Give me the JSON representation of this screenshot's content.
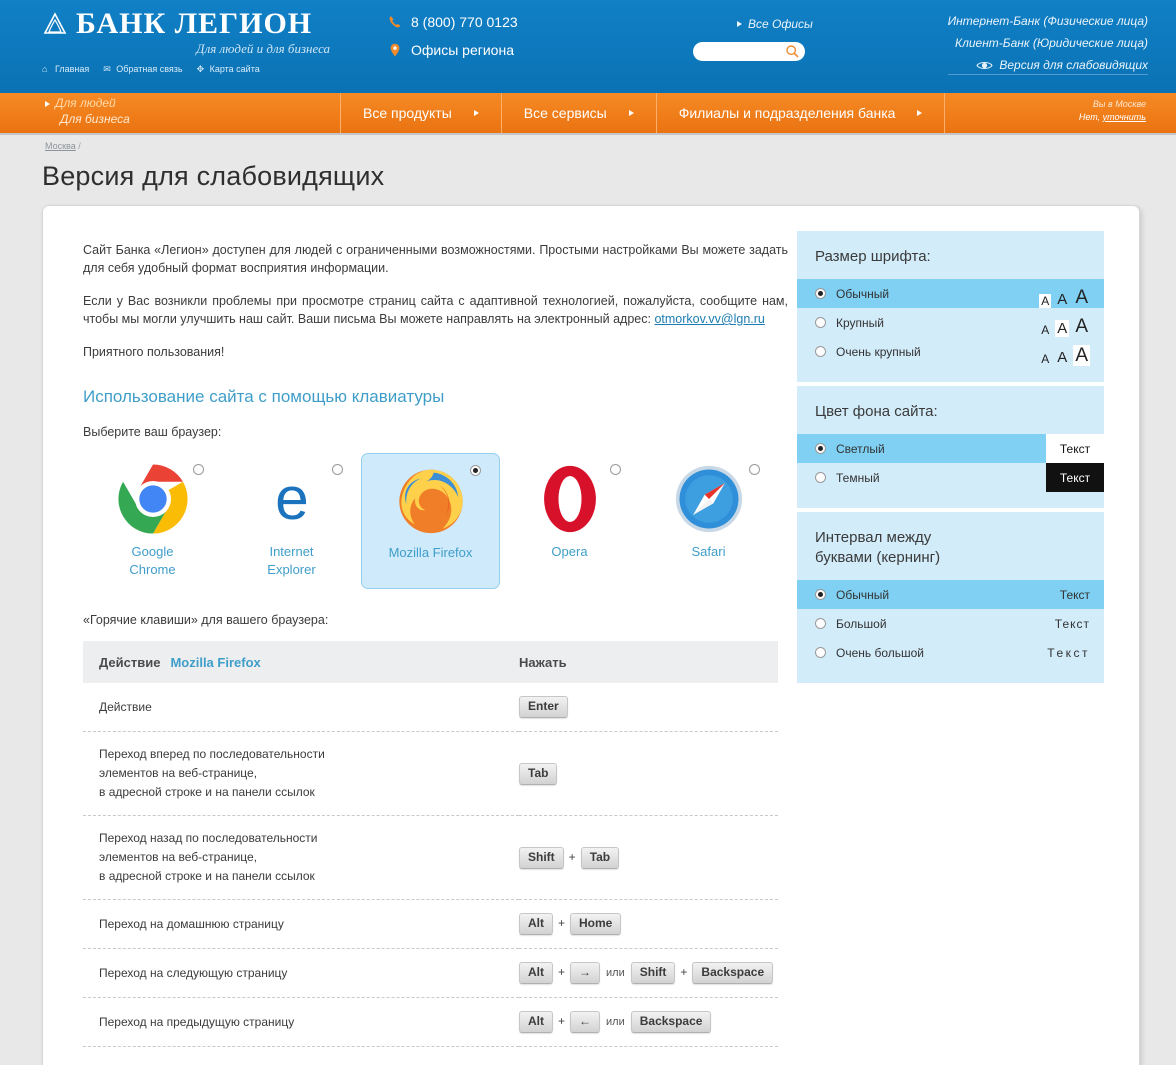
{
  "header": {
    "logo_name": "БАНК ЛЕГИОН",
    "logo_tagline": "Для людей и для бизнеса",
    "top_links": [
      {
        "icon": "home-icon",
        "label": "Главная"
      },
      {
        "icon": "envelope-icon",
        "label": "Обратная связь"
      },
      {
        "icon": "sitemap-icon",
        "label": "Карта сайта"
      }
    ],
    "phone": "8 (800) 770 0123",
    "offices_region": "Офисы региона",
    "all_offices": "Все Офисы",
    "search_placeholder": "",
    "search_value": "",
    "right_links": [
      "Интернет-Банк (Физические лица)",
      "Клиент-Банк (Юридические лица)"
    ],
    "accessibility_link": "Версия для слабовидящих"
  },
  "nav": {
    "audience": [
      {
        "label": "Для людей",
        "active": true
      },
      {
        "label": "Для бизнеса",
        "active": false
      }
    ],
    "items": [
      "Все продукты",
      "Все сервисы",
      "Филиалы и подразделения банка"
    ],
    "geo_line1": "Вы в Москве",
    "geo_line2_prefix": "Нет, ",
    "geo_line2_link": "уточнить"
  },
  "breadcrumb": {
    "city": "Москва",
    "separator": "/"
  },
  "page_title": "Версия для слабовидящих",
  "content": {
    "paragraph1": "Сайт Банка «Легион» доступен для людей с ограниченными возможностями. Простыми настройками Вы можете задать для себя удобный формат восприятия информации.",
    "paragraph2_before": "Если у Вас возникли проблемы при просмотре страниц сайта с адаптивной технологией, пожалуйста, сообщите нам, чтобы мы могли улучшить наш сайт. Ваши письма Вы можете направлять на электронный адрес: ",
    "email": "otmorkov.vv@lgn.ru",
    "paragraph3": "Приятного пользования!",
    "section_heading": "Использование сайта с помощью клавиатуры",
    "browser_prompt": "Выберите ваш браузер:",
    "hotkeys_prompt": "«Горячие клавиши» для вашего браузера:"
  },
  "browsers": [
    {
      "name": "Google\nChrome",
      "line1": "Google",
      "line2": "Chrome",
      "icon": "chrome-icon",
      "selected": false
    },
    {
      "name": "Internet Explorer",
      "line1": "Internet",
      "line2": "Explorer",
      "icon": "edge-icon",
      "selected": false
    },
    {
      "name": "Mozilla Firefox",
      "line1": "Mozilla Firefox",
      "line2": "",
      "icon": "firefox-icon",
      "selected": true
    },
    {
      "name": "Opera",
      "line1": "Opera",
      "line2": "",
      "icon": "opera-icon",
      "selected": false
    },
    {
      "name": "Safari",
      "line1": "Safari",
      "line2": "",
      "icon": "safari-icon",
      "selected": false
    }
  ],
  "table": {
    "head_action": "Действие",
    "head_browser": "Mozilla Firefox",
    "head_press": "Нажать",
    "rows": [
      {
        "action": "Действие",
        "keys": [
          {
            "t": "key",
            "v": "Enter"
          }
        ]
      },
      {
        "action": "Переход вперед по последовательности\nэлементов на веб-странице,\nв адресной строке и на панели ссылок",
        "keys": [
          {
            "t": "key",
            "v": "Tab"
          }
        ]
      },
      {
        "action": "Переход назад по последовательности\nэлементов на веб-странице,\nв адресной строке и на панели ссылок",
        "keys": [
          {
            "t": "key",
            "v": "Shift"
          },
          {
            "t": "plus",
            "v": "+"
          },
          {
            "t": "key",
            "v": "Tab"
          }
        ]
      },
      {
        "action": "Переход на домашнюю страницу",
        "keys": [
          {
            "t": "key",
            "v": "Alt"
          },
          {
            "t": "plus",
            "v": "+"
          },
          {
            "t": "key",
            "v": "Home"
          }
        ]
      },
      {
        "action": "Переход на следующую страницу",
        "keys": [
          {
            "t": "key",
            "v": "Alt"
          },
          {
            "t": "plus",
            "v": "+"
          },
          {
            "t": "key",
            "v": "→"
          },
          {
            "t": "or",
            "v": "или"
          },
          {
            "t": "key",
            "v": "Shift"
          },
          {
            "t": "plus",
            "v": "+"
          },
          {
            "t": "key",
            "v": "Backspace"
          }
        ]
      },
      {
        "action": "Переход на предыдущую страницу",
        "keys": [
          {
            "t": "key",
            "v": "Alt"
          },
          {
            "t": "plus",
            "v": "+"
          },
          {
            "t": "key",
            "v": "←"
          },
          {
            "t": "or",
            "v": "или"
          },
          {
            "t": "key",
            "v": "Backspace"
          }
        ]
      }
    ]
  },
  "sidebar": {
    "font_size": {
      "title": "Размер шрифта:",
      "options": [
        {
          "label": "Обычный",
          "selected": true,
          "highlight": 0
        },
        {
          "label": "Крупный",
          "selected": false,
          "highlight": 1
        },
        {
          "label": "Очень крупный",
          "selected": false,
          "highlight": 2
        }
      ],
      "sample_letter": "A"
    },
    "background": {
      "title": "Цвет фона сайта:",
      "options": [
        {
          "label": "Светлый",
          "selected": true,
          "sample": "Текст",
          "mode": "light"
        },
        {
          "label": "Темный",
          "selected": false,
          "sample": "Текст",
          "mode": "dark"
        }
      ]
    },
    "kerning": {
      "title": "Интервал между\nбуквами (кернинг)",
      "title_line1": "Интервал между",
      "title_line2": "буквами (кернинг)",
      "options": [
        {
          "label": "Обычный",
          "selected": true,
          "sample": "Текст",
          "level": 1
        },
        {
          "label": "Большой",
          "selected": false,
          "sample": "Текст",
          "level": 2
        },
        {
          "label": "Очень большой",
          "selected": false,
          "sample": "Текст",
          "level": 3
        }
      ]
    }
  },
  "colors": {
    "header_blue": "#0d78bd",
    "nav_orange": "#f07d1a",
    "link_blue": "#3f9ec9",
    "panel_blue": "#d3ecfa",
    "panel_selected": "#7fd0f3"
  }
}
